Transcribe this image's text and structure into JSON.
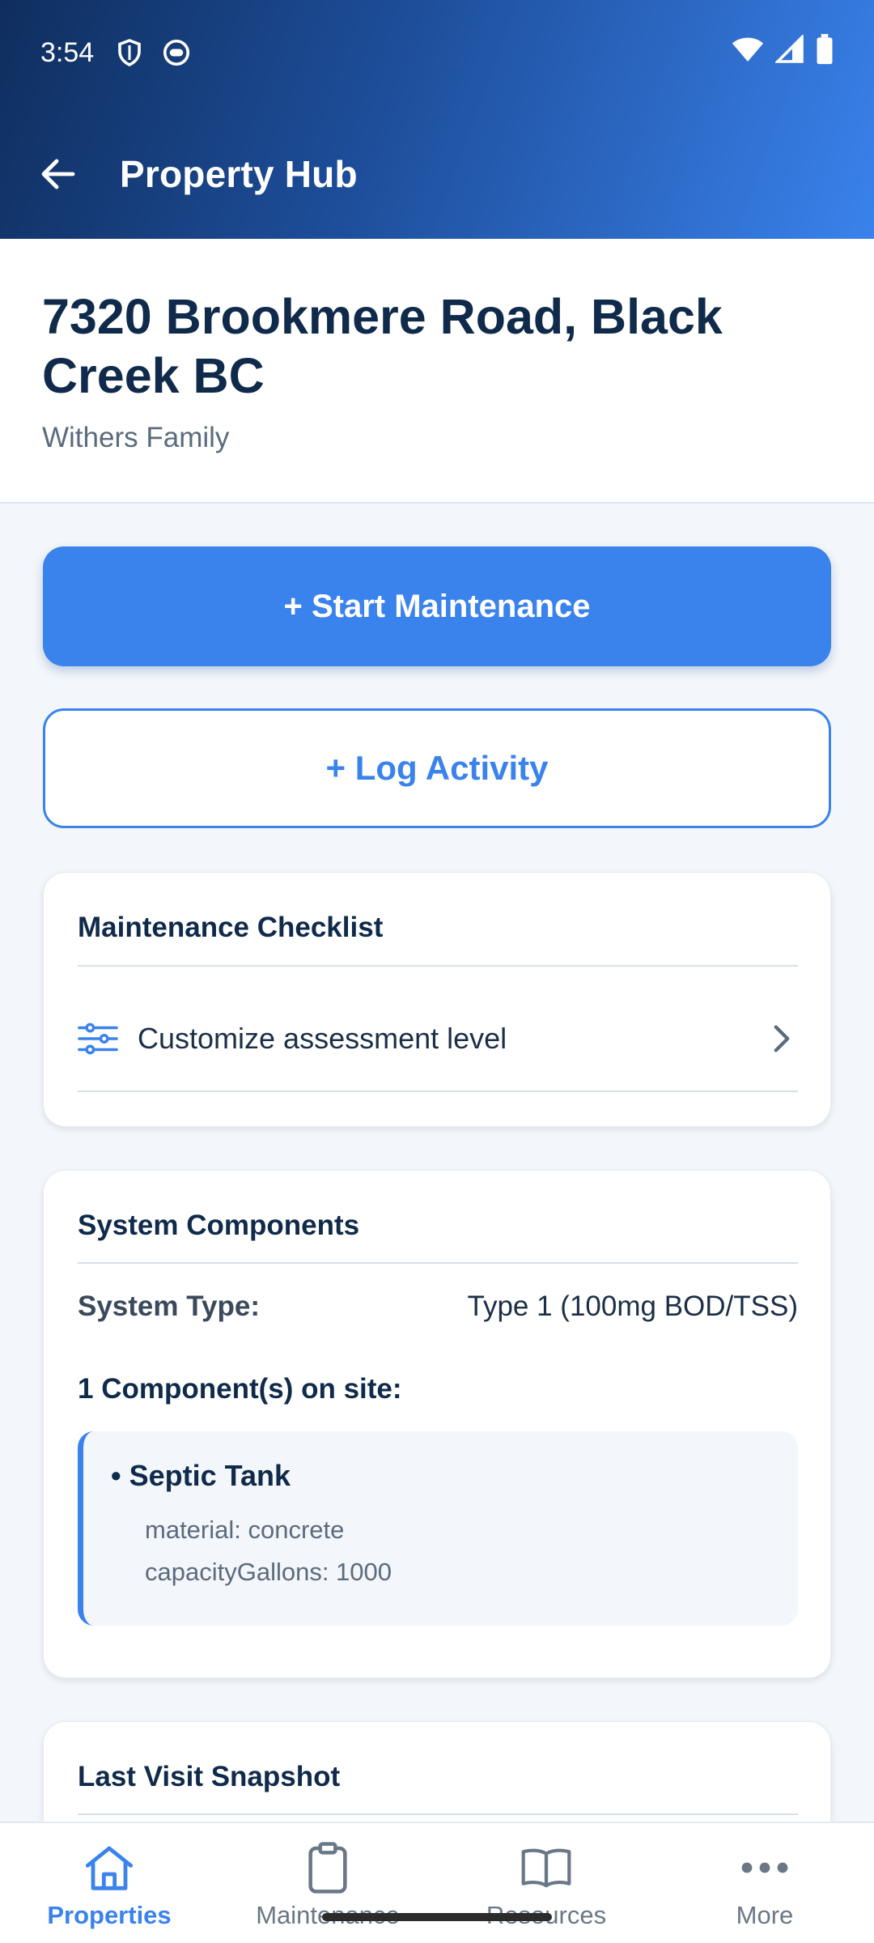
{
  "status_bar": {
    "time": "3:54",
    "icons": [
      "shield-icon",
      "face-icon",
      "wifi-icon",
      "signal-icon",
      "battery-icon"
    ]
  },
  "app_bar": {
    "title": "Property Hub",
    "back_icon": "arrow-left-icon"
  },
  "property": {
    "address": "7320 Brookmere Road, Black Creek BC",
    "owner": "Withers Family"
  },
  "actions": {
    "start_maintenance": "+ Start Maintenance",
    "log_activity": "+ Log Activity"
  },
  "checklist": {
    "title": "Maintenance Checklist",
    "row_label": "Customize assessment level",
    "row_icon": "sliders-icon"
  },
  "components": {
    "title": "System Components",
    "system_type_label": "System Type:",
    "system_type_value": "Type 1 (100mg BOD/TSS)",
    "count_label": "1 Component(s) on site:",
    "items": [
      {
        "name": "• Septic Tank",
        "attrs": [
          "material: concrete",
          "capacityGallons: 1000"
        ]
      }
    ]
  },
  "snapshot": {
    "title": "Last Visit Snapshot"
  },
  "bottom_nav": {
    "items": [
      {
        "label": "Properties",
        "icon": "home-icon",
        "active": true
      },
      {
        "label": "Maintenance",
        "icon": "clipboard-icon",
        "active": false
      },
      {
        "label": "Resources",
        "icon": "book-icon",
        "active": false
      },
      {
        "label": "More",
        "icon": "more-dots-icon",
        "active": false
      }
    ]
  },
  "colors": {
    "accent": "#3a82ec",
    "header_dark": "#0f2e5e",
    "text_primary": "#0f2a4a"
  }
}
